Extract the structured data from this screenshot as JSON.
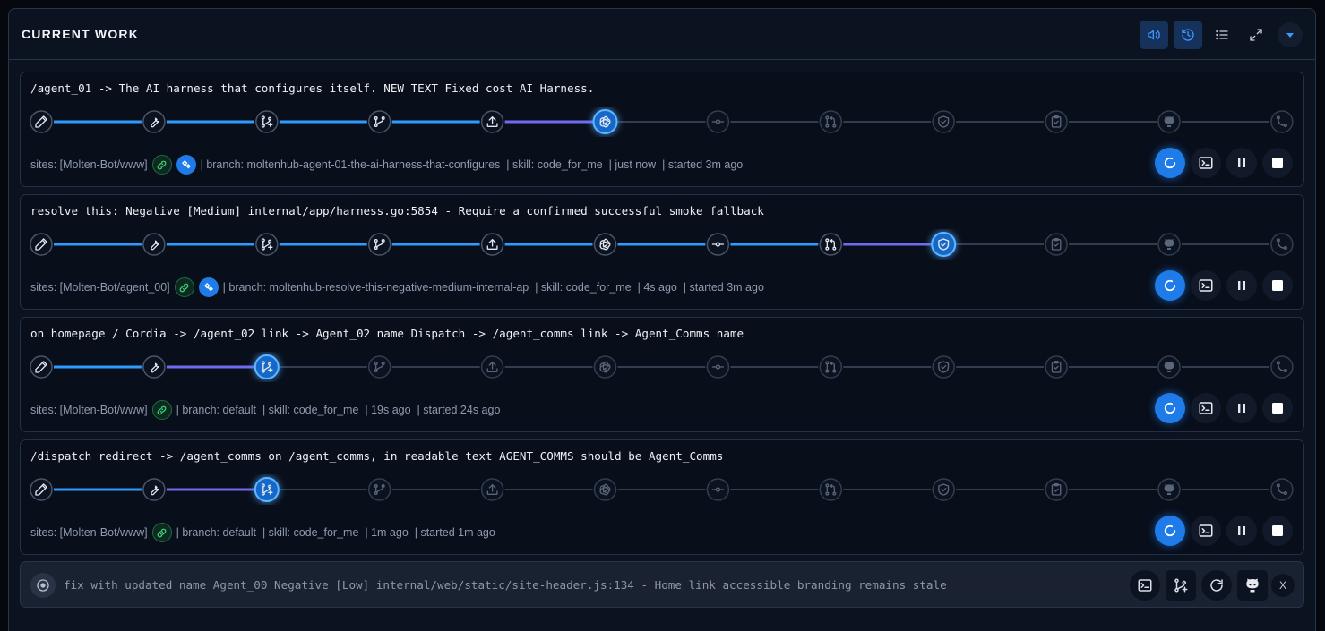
{
  "header": {
    "title": "CURRENT WORK",
    "buttons": [
      "speaker-icon",
      "history-icon",
      "list-icon",
      "expand-icon",
      "chevron-down-icon"
    ]
  },
  "stage_icons": [
    "pencil-icon",
    "wrench-icon",
    "branch-plus-icon",
    "git-branch-icon",
    "upload-icon",
    "openai-icon",
    "commit-icon",
    "pull-request-icon",
    "shield-check-icon",
    "clipboard-check-icon",
    "github-icon",
    "merge-icon"
  ],
  "colors": {
    "accent": "#1e7be8",
    "done": "#2f9bff",
    "active_glow": "#3ea6ff",
    "pending": "#3a4558"
  },
  "tasks": [
    {
      "title": "/agent_01 -> The AI harness that configures itself. NEW TEXT Fixed cost AI Harness.",
      "sites": "sites: [Molten-Bot/www]",
      "chips": [
        "link",
        "blue"
      ],
      "details": "| branch: moltenhub-agent-01-the-ai-harness-that-configures  | skill: code_for_me  | just now  | started 3m ago",
      "active_stage": 5
    },
    {
      "title": "resolve this: Negative [Medium] internal/app/harness.go:5854 - Require a confirmed successful smoke fallback",
      "sites": "sites: [Molten-Bot/agent_00]",
      "chips": [
        "link",
        "blue"
      ],
      "details": "| branch: moltenhub-resolve-this-negative-medium-internal-ap  | skill: code_for_me  | 4s ago  | started 3m ago",
      "active_stage": 8
    },
    {
      "title": "on homepage / Cordia -> /agent_02 link -> Agent_02 name Dispatch -> /agent_comms link -> Agent_Comms name",
      "sites": "sites: [Molten-Bot/www]",
      "chips": [
        "link"
      ],
      "details": "| branch: default  | skill: code_for_me  | 19s ago  | started 24s ago",
      "active_stage": 2
    },
    {
      "title": "/dispatch redirect -> /agent_comms on /agent_comms, in readable text AGENT_COMMS should be Agent_Comms",
      "sites": "sites: [Molten-Bot/www]",
      "chips": [
        "link"
      ],
      "details": "| branch: default  | skill: code_for_me  | 1m ago  | started 1m ago",
      "active_stage": 2
    }
  ],
  "task_actions": [
    "refresh-icon",
    "terminal-icon",
    "pause-icon",
    "stop-icon"
  ],
  "composer": {
    "text": "fix with updated name Agent_00 Negative [Low] internal/web/static/site-header.js:134 - Home link accessible branding remains stale",
    "close_label": "X"
  }
}
